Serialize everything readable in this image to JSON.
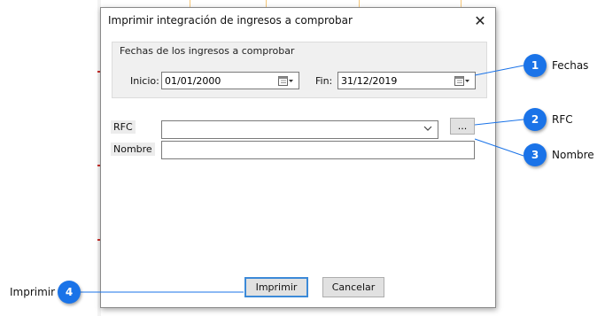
{
  "dialog": {
    "title": "Imprimir integración de ingresos a comprobar",
    "close_glyph": "✕"
  },
  "dates_group": {
    "legend": "Fechas de los ingresos a comprobar",
    "start_label": "Inicio:",
    "start_value": "01/01/2000",
    "end_label": "Fin:",
    "end_value": "31/12/2019"
  },
  "rfc": {
    "label": "RFC",
    "value": "",
    "browse_label": "..."
  },
  "nombre": {
    "label": "Nombre",
    "value": ""
  },
  "buttons": {
    "print": "Imprimir",
    "cancel": "Cancelar"
  },
  "callouts": [
    {
      "number": "1",
      "label": "Fechas"
    },
    {
      "number": "2",
      "label": "RFC"
    },
    {
      "number": "3",
      "label": "Nombre"
    },
    {
      "number": "4",
      "label": "Imprimir"
    }
  ],
  "colors": {
    "callout": "#1a73e8",
    "default_button_border": "#3c8ad8"
  },
  "icons": {
    "calendar": "calendar-icon",
    "dropdown": "chevron-down-icon",
    "close": "close-icon"
  }
}
